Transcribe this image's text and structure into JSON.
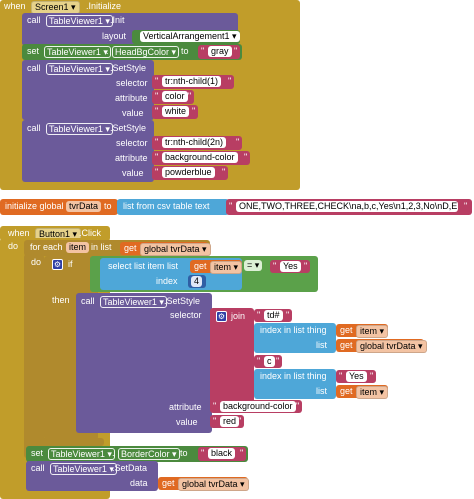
{
  "init_block": {
    "when": "when",
    "component": "Screen1",
    "event": ".Initialize",
    "do": "do",
    "call1": {
      "call": "call",
      "component": "TableViewer1",
      "method": ".Init",
      "param_layout": "layout",
      "layout_value": "VerticalArrangement1"
    },
    "set1": {
      "set": "set",
      "component": "TableViewer1",
      "property": "HeadBgColor",
      "to": "to",
      "value": "gray"
    },
    "call2": {
      "call": "call",
      "component": "TableViewer1",
      "method": ".SetStyle",
      "p_selector": "selector",
      "v_selector": "tr:nth-child(1)",
      "p_attribute": "attribute",
      "v_attribute": "color",
      "p_value": "value",
      "v_value": "white"
    },
    "call3": {
      "call": "call",
      "component": "TableViewer1",
      "method": ".SetStyle",
      "p_selector": "selector",
      "v_selector": "tr:nth-child(2n)",
      "p_attribute": "attribute",
      "v_attribute": "background-color",
      "p_value": "value",
      "v_value": "powderblue"
    }
  },
  "global_block": {
    "initialize": "initialize global",
    "name": "tvrData",
    "to": "to",
    "func": "list from csv table  text",
    "csv": "ONE,TWO,THREE,CHECK\\na,b,c,Yes\\n1,2,3,No\\nD,E,F,"
  },
  "click_block": {
    "when": "when",
    "component": "Button1",
    "event": ".Click",
    "do": "do",
    "foreach": {
      "for_each": "for each",
      "item": "item",
      "in_list": "in list",
      "get": "get",
      "list_var": "global tvrData",
      "do": "do"
    },
    "if": {
      "if": "if",
      "select": "select list item  list",
      "get": "get",
      "item_var": "item",
      "index": "index",
      "index_value": "4",
      "op": "=",
      "compare": "Yes"
    },
    "then": "then",
    "setstyle": {
      "call": "call",
      "component": "TableViewer1",
      "method": ".SetStyle",
      "p_selector": "selector",
      "join": "join",
      "s1": "td#",
      "idx1": "index in list  thing",
      "get": "get",
      "item_var": "item",
      "list": "list",
      "list_var": "global tvrData",
      "s2": "c",
      "idx2": "index in list  thing",
      "thing2": "Yes",
      "list2": "list",
      "item_var2": "item",
      "p_attribute": "attribute",
      "v_attribute": "background-color",
      "p_value": "value",
      "v_value": "red"
    },
    "set": {
      "set": "set",
      "component": "TableViewer1",
      "property": "BorderColor",
      "to": "to",
      "value": "black"
    },
    "setdata": {
      "call": "call",
      "component": "TableViewer1",
      "method": ".SetData",
      "p_data": "data",
      "get": "get",
      "data_var": "global tvrData"
    }
  },
  "colors": {
    "event": "#c19d2a",
    "component": "#6b5a9a",
    "setter": "#4b8a3e",
    "list": "#4ea7d8",
    "text": "#b83e63",
    "variable": "#e06a22",
    "logic": "#5ba14a",
    "math": "#2f5fa5"
  }
}
